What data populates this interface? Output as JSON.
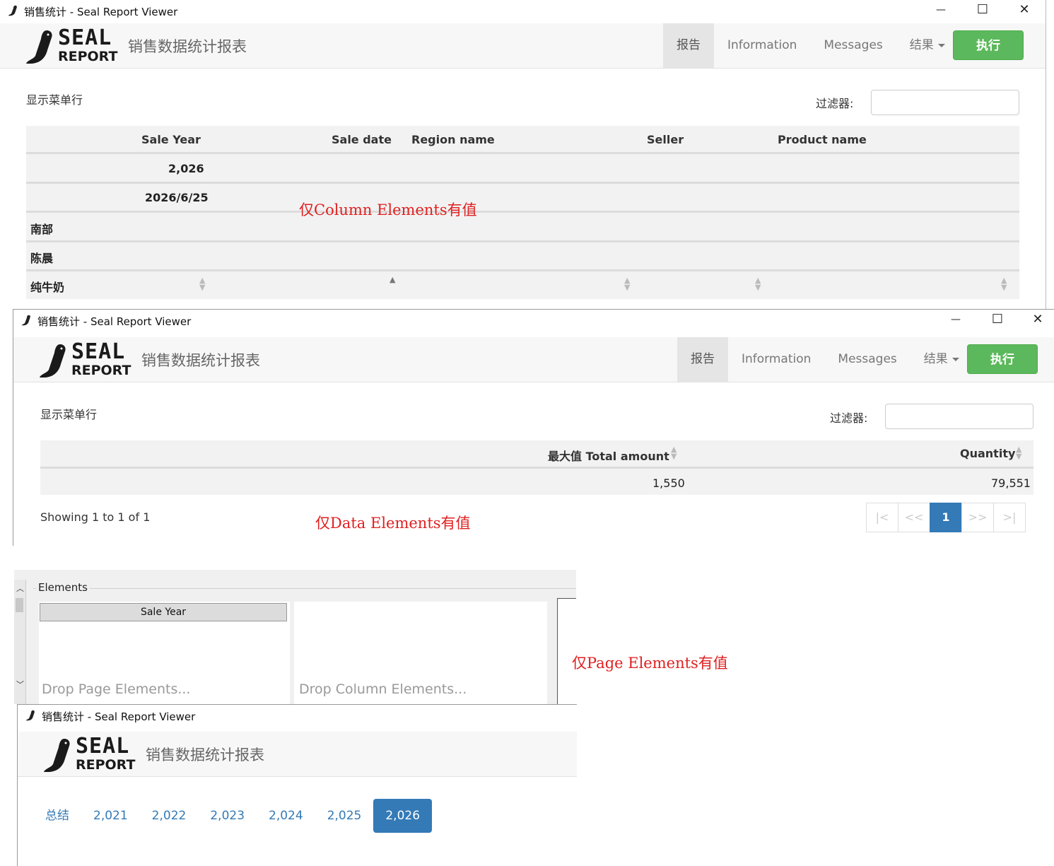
{
  "window_title": "销售统计 - Seal Report Viewer",
  "logo": {
    "seal": "SEAL",
    "report": "REPORT"
  },
  "report_title": "销售数据统计报表",
  "nav": {
    "report": "报告",
    "information": "Information",
    "messages": "Messages",
    "results": "结果",
    "execute": "执行"
  },
  "menu_toggle": "显示菜单行",
  "filter_label": "过滤器:",
  "window_controls": {
    "minimize": "—",
    "maximize": "☐",
    "close": "✕"
  },
  "view1": {
    "headers": [
      "Sale Year",
      "Sale date",
      "Region name",
      "Seller",
      "Product name"
    ],
    "rows": [
      "2,026",
      "2026/6/25",
      "南部",
      "陈晨",
      "纯牛奶"
    ],
    "note": "仅Column Elements有值"
  },
  "view2": {
    "headers": [
      "最大值 Total amount",
      "Quantity"
    ],
    "values": [
      "1,550",
      "79,551"
    ],
    "showing": "Showing 1 to 1 of 1",
    "pager": [
      "|<",
      "<<",
      "1",
      ">>",
      ">|"
    ],
    "note": "仅Data Elements有值"
  },
  "designer": {
    "group_label": "Elements",
    "page_element": "Sale Year",
    "drop_page": "Drop Page Elements...",
    "drop_column": "Drop Column Elements...",
    "note": "仅Page Elements有值"
  },
  "view3": {
    "tabs": [
      "总结",
      "2,021",
      "2,022",
      "2,023",
      "2,024",
      "2,025",
      "2,026"
    ]
  }
}
